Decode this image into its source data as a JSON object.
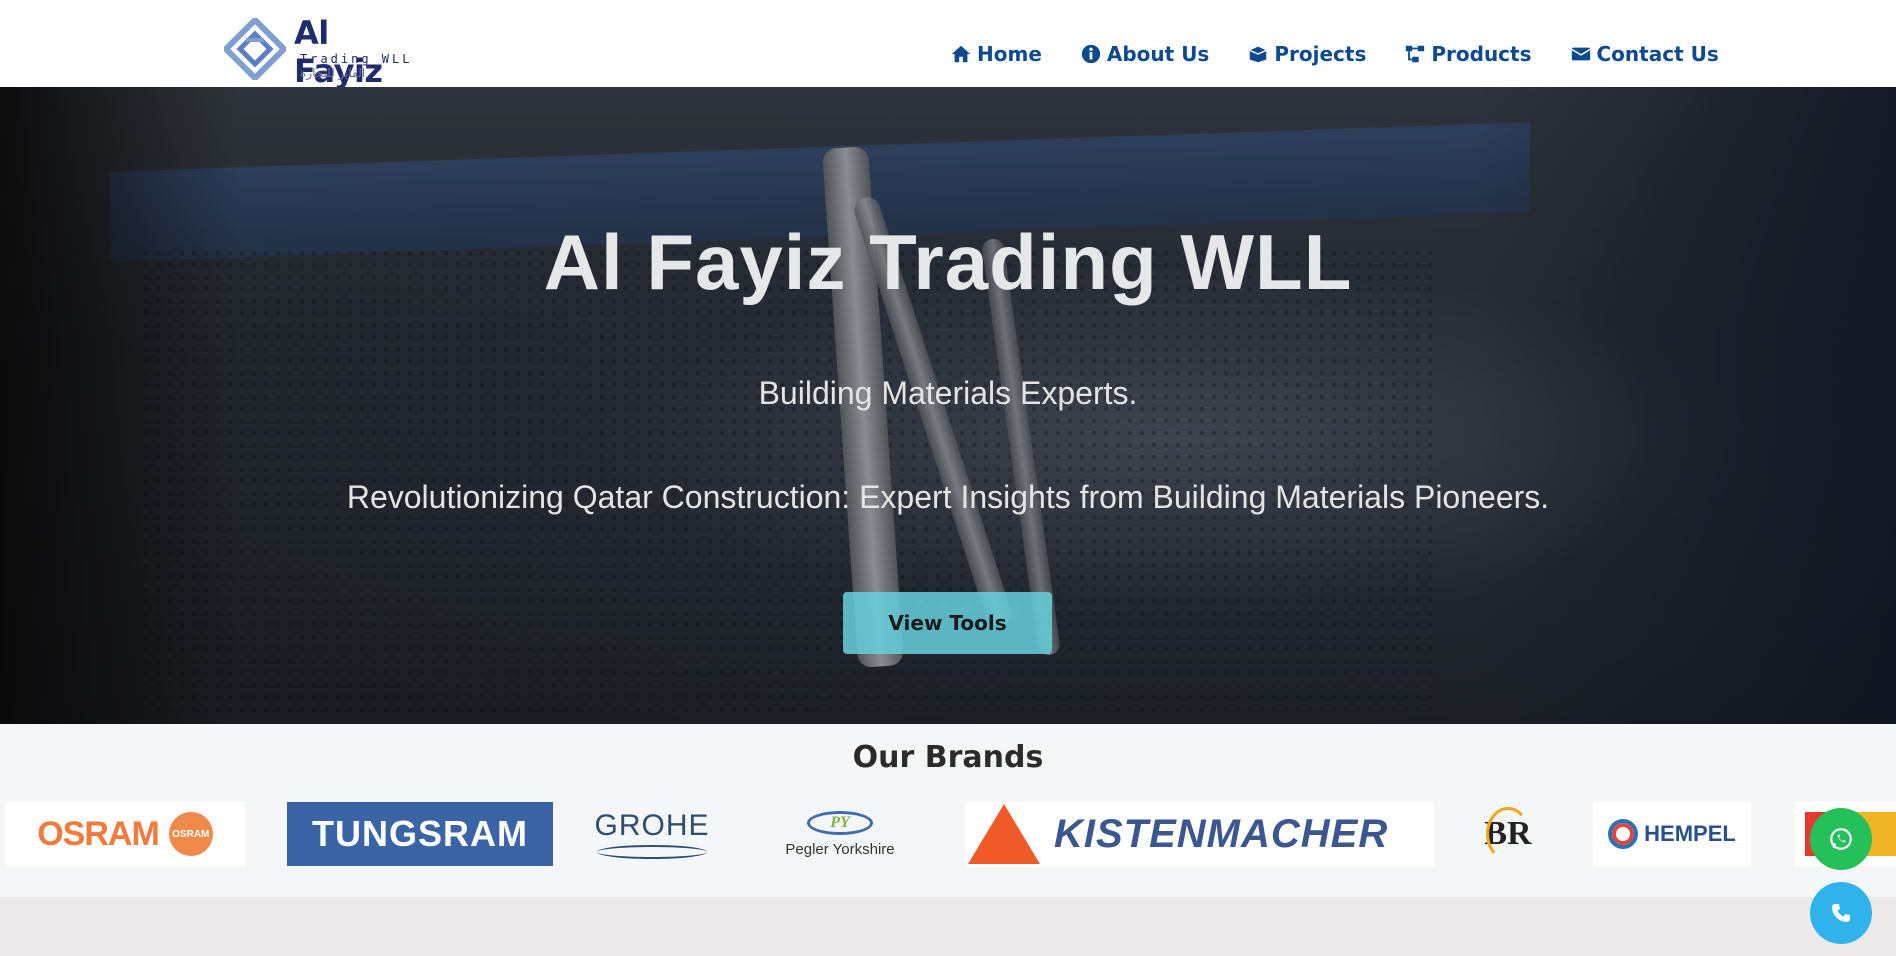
{
  "header": {
    "logo": {
      "name": "Al Fayiz",
      "sub": "Trading WLL",
      "arabic": "الفايز للتجارة"
    },
    "nav": [
      {
        "label": "Home",
        "icon": "home-icon"
      },
      {
        "label": "About Us",
        "icon": "info-icon"
      },
      {
        "label": "Projects",
        "icon": "box-icon"
      },
      {
        "label": "Products",
        "icon": "sitemap-icon"
      },
      {
        "label": "Contact Us",
        "icon": "envelope-icon"
      }
    ],
    "accent": "#0d4a8f"
  },
  "hero": {
    "title": "Al Fayiz Trading WLL",
    "tagline": "Building Materials Experts.",
    "subtitle": "Revolutionizing Qatar Construction: Expert Insights from Building Materials Pioneers.",
    "button_label": "View Tools",
    "button_color": "#66d0dd"
  },
  "brands": {
    "title": "Our Brands",
    "items": [
      {
        "name": "OSRAM",
        "badge": "OSRAM"
      },
      {
        "name": "TUNGSRAM"
      },
      {
        "name": "GROHE"
      },
      {
        "name": "Pegler Yorkshire",
        "badge": "PY"
      },
      {
        "name": "KISTENMACHER"
      },
      {
        "name": "BR"
      },
      {
        "name": "HEMPEL"
      }
    ]
  },
  "floating": {
    "whatsapp_color": "#25c05a",
    "call_color": "#2fb3ea"
  }
}
